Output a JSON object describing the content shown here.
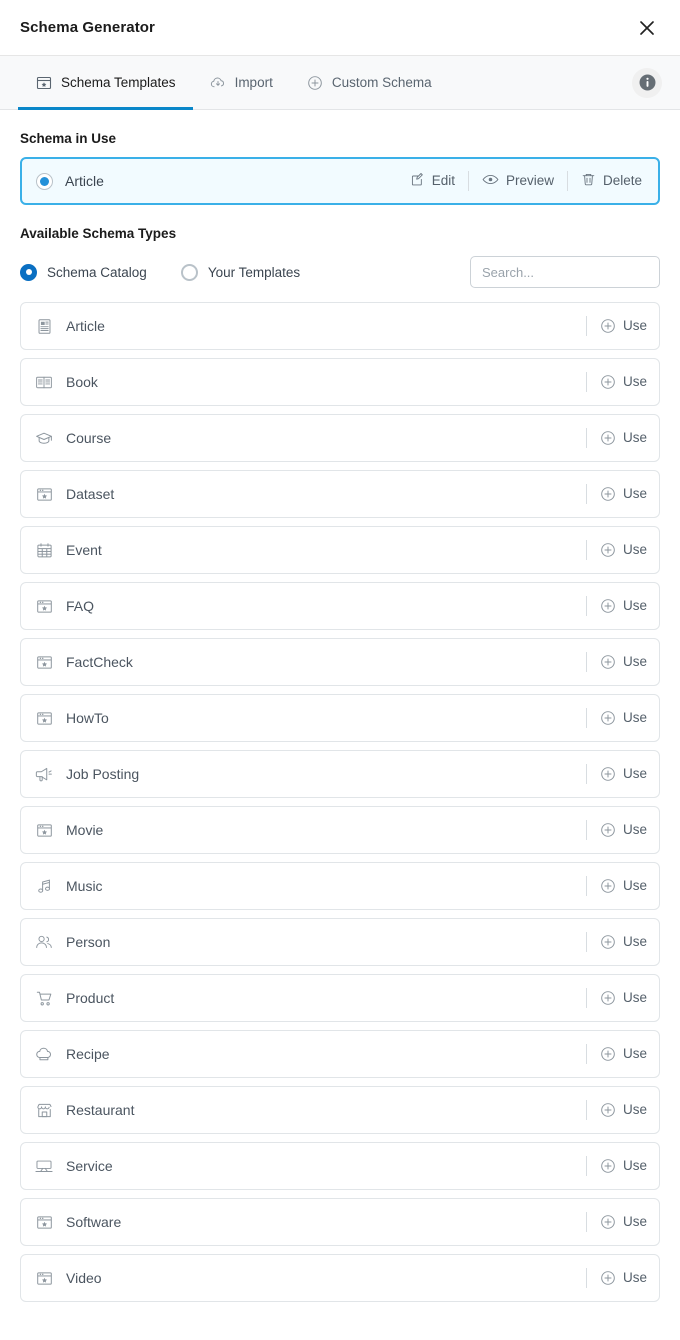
{
  "window": {
    "title": "Schema Generator",
    "close_icon": "close-icon"
  },
  "tabs": [
    {
      "label": "Schema Templates",
      "icon": "window-star-icon",
      "active": true
    },
    {
      "label": "Import",
      "icon": "cloud-download-icon",
      "active": false
    },
    {
      "label": "Custom Schema",
      "icon": "plus-circle-icon",
      "active": false
    }
  ],
  "info_button": {
    "icon": "info-icon",
    "label": "i"
  },
  "schema_in_use": {
    "heading": "Schema in Use",
    "name": "Article",
    "selected": true,
    "actions": [
      {
        "label": "Edit",
        "icon": "pencil-square-icon"
      },
      {
        "label": "Preview",
        "icon": "eye-icon"
      },
      {
        "label": "Delete",
        "icon": "trash-icon"
      }
    ]
  },
  "available": {
    "heading": "Available Schema Types",
    "filters": [
      {
        "label": "Schema Catalog",
        "selected": true
      },
      {
        "label": "Your Templates",
        "selected": false
      }
    ],
    "search": {
      "value": "",
      "placeholder": "Search..."
    },
    "use_label": "Use",
    "use_icon": "plus-circle-icon",
    "items": [
      {
        "label": "Article",
        "icon": "document-icon"
      },
      {
        "label": "Book",
        "icon": "open-book-icon"
      },
      {
        "label": "Course",
        "icon": "graduation-cap-icon"
      },
      {
        "label": "Dataset",
        "icon": "window-star-icon"
      },
      {
        "label": "Event",
        "icon": "calendar-icon"
      },
      {
        "label": "FAQ",
        "icon": "window-star-icon"
      },
      {
        "label": "FactCheck",
        "icon": "window-star-icon"
      },
      {
        "label": "HowTo",
        "icon": "window-star-icon"
      },
      {
        "label": "Job Posting",
        "icon": "megaphone-icon"
      },
      {
        "label": "Movie",
        "icon": "window-star-icon"
      },
      {
        "label": "Music",
        "icon": "music-note-icon"
      },
      {
        "label": "Person",
        "icon": "people-icon"
      },
      {
        "label": "Product",
        "icon": "shopping-cart-icon"
      },
      {
        "label": "Recipe",
        "icon": "chef-hat-icon"
      },
      {
        "label": "Restaurant",
        "icon": "storefront-icon"
      },
      {
        "label": "Service",
        "icon": "monitor-icon"
      },
      {
        "label": "Software",
        "icon": "window-star-icon"
      },
      {
        "label": "Video",
        "icon": "window-star-icon"
      }
    ]
  },
  "colors": {
    "accent": "#0a87c9",
    "accent_radio": "#0a6fc2",
    "card_border": "#3ab0e8",
    "card_bg": "#f2fbff",
    "tabbar_bg": "#f8f9fa",
    "row_border": "#e1e5e8",
    "text": "#1b1b1b",
    "muted": "#8d969e"
  }
}
